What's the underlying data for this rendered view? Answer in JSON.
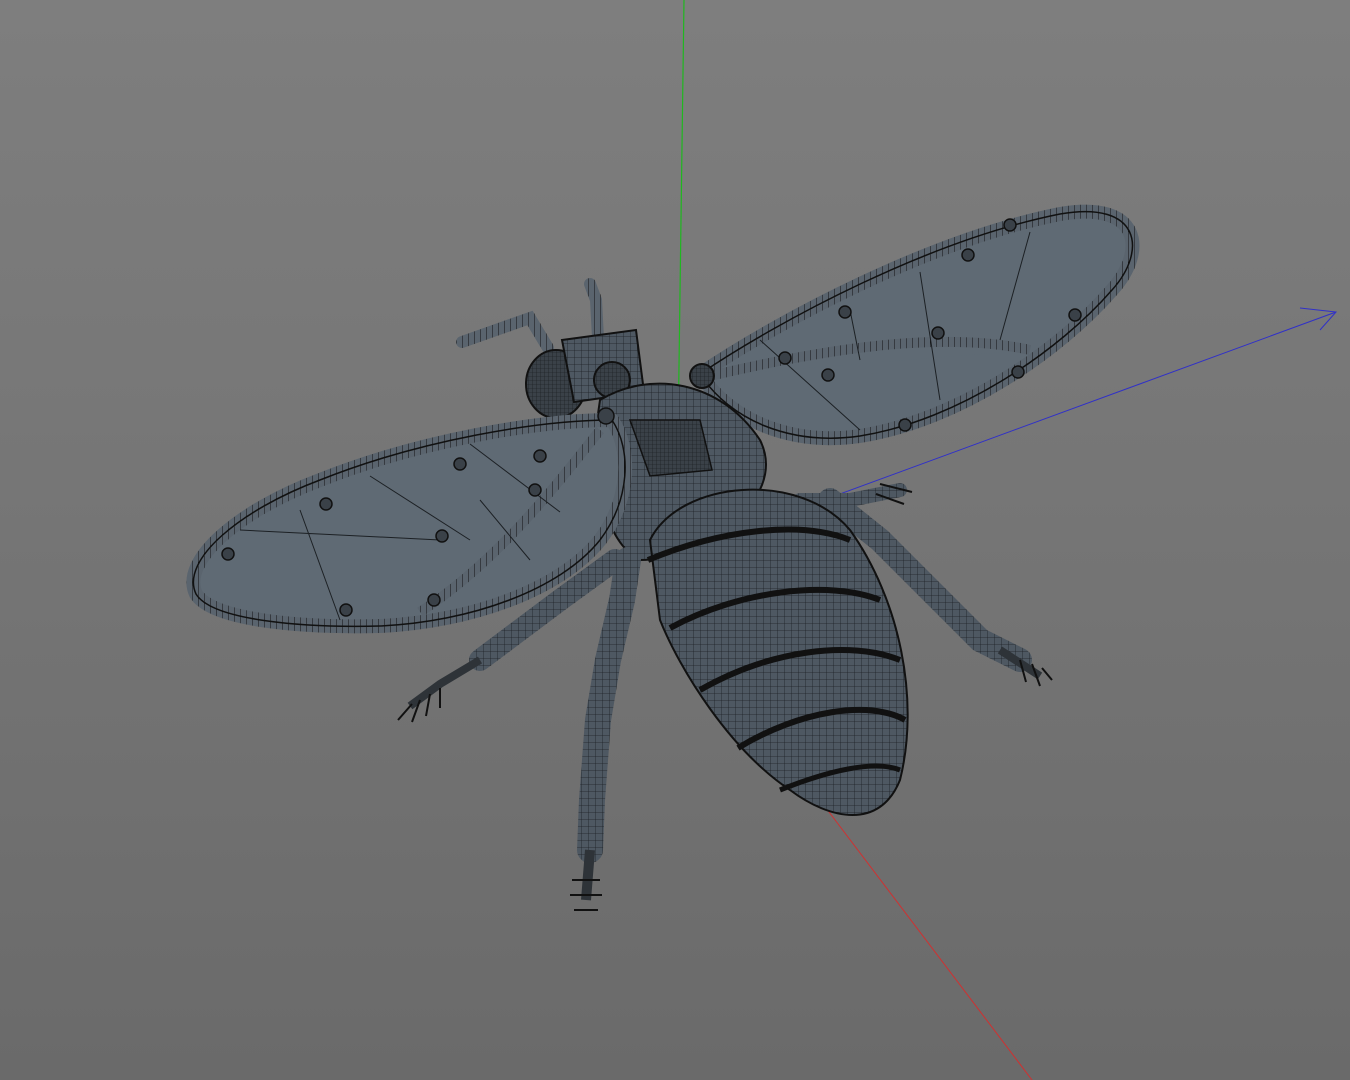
{
  "viewport": {
    "background_top": "#7e7e7e",
    "background_bottom": "#6a6a6a"
  },
  "axes": {
    "x_color": "#d03030",
    "y_color": "#1fb81f",
    "z_color": "#3030c8"
  },
  "model": {
    "name": "bee-wireframe-mesh",
    "mesh_color": "#4e5862",
    "wire_color": "#1c2024",
    "wing_fill": "#5f6a74"
  }
}
